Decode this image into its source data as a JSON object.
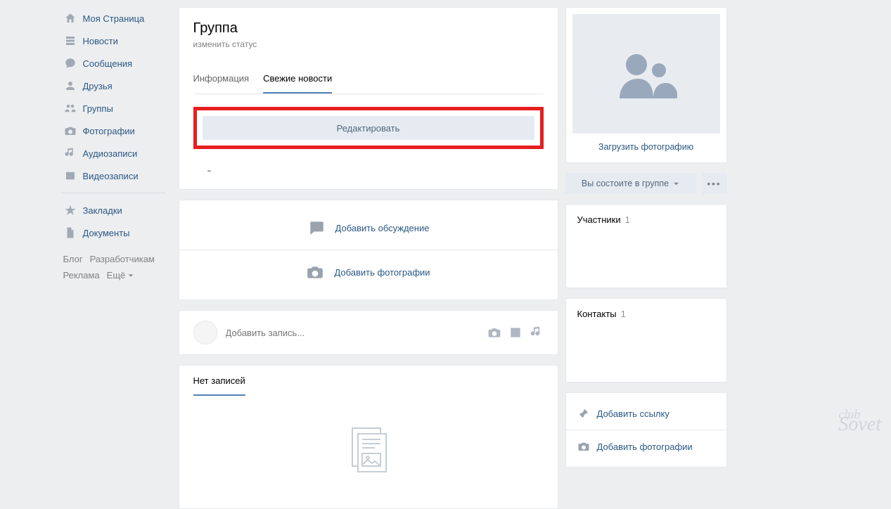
{
  "sidebar": {
    "items": [
      {
        "label": "Моя Страница"
      },
      {
        "label": "Новости"
      },
      {
        "label": "Сообщения"
      },
      {
        "label": "Друзья"
      },
      {
        "label": "Группы"
      },
      {
        "label": "Фотографии"
      },
      {
        "label": "Аудиозаписи"
      },
      {
        "label": "Видеозаписи"
      }
    ],
    "items2": [
      {
        "label": "Закладки"
      },
      {
        "label": "Документы"
      }
    ]
  },
  "footer": {
    "blog": "Блог",
    "dev": "Разработчикам",
    "ad": "Реклама",
    "more": "Ещё"
  },
  "header": {
    "title": "Группа",
    "status": "изменить статус"
  },
  "tabs": {
    "info": "Информация",
    "news": "Свежие новости"
  },
  "buttons": {
    "edit": "Редактировать"
  },
  "add": {
    "discuss": "Добавить обсуждение",
    "photos": "Добавить фотографии"
  },
  "post": {
    "placeholder": "Добавить запись..."
  },
  "noPosts": "Нет записей",
  "right": {
    "upload": "Загрузить фотографию",
    "member": "Вы состоите в группе",
    "members": "Участники",
    "membersCount": "1",
    "contacts": "Контакты",
    "contactsCount": "1",
    "addLink": "Добавить ссылку",
    "addPhotos": "Добавить фотографии"
  },
  "watermark": {
    "t": "club",
    "b": "Sovet"
  }
}
